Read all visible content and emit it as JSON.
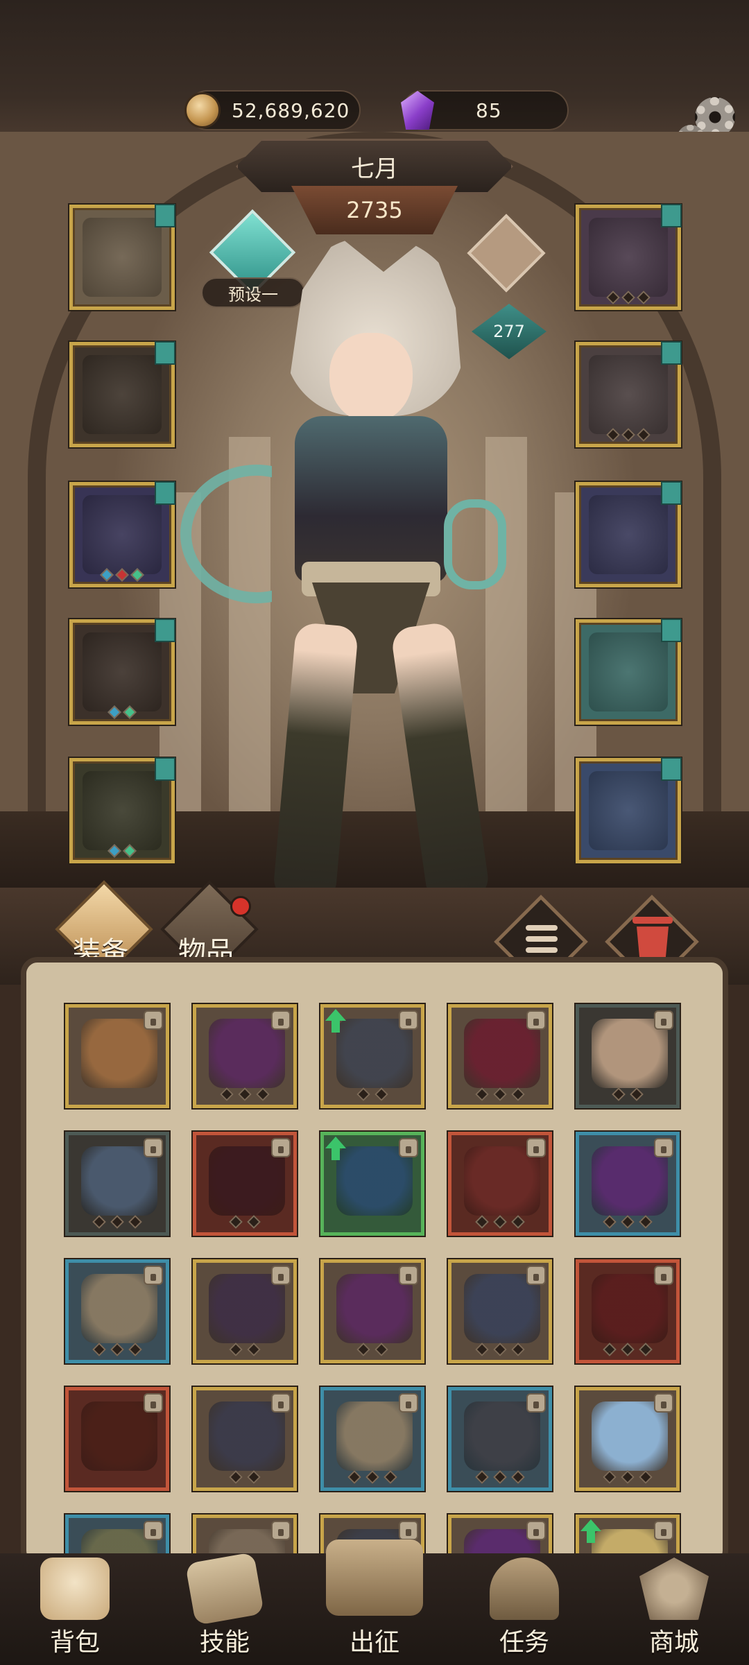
{
  "currencies": {
    "gold": "52,689,620",
    "gems": "85",
    "gold_icon": "gold-coin-icon",
    "gem_icon": "purple-crystal-icon"
  },
  "character": {
    "name": "七月",
    "power": "2735",
    "level": "277"
  },
  "preset": {
    "label": "预设一",
    "icon": "preset-gem-icon"
  },
  "equipment_slots": {
    "left": [
      {
        "name": "wings-slot",
        "sockets": []
      },
      {
        "name": "empty-armor-slot",
        "sockets": []
      },
      {
        "name": "shoulder-slot",
        "sockets": [
          "blue",
          "red",
          "green"
        ]
      },
      {
        "name": "pants-slot",
        "sockets": [
          "blue",
          "green"
        ]
      },
      {
        "name": "boots-slot",
        "sockets": [
          "blue",
          "green"
        ]
      }
    ],
    "right": [
      {
        "name": "necklace-slot",
        "sockets": [
          "empty",
          "empty",
          "empty"
        ]
      },
      {
        "name": "ring-slot",
        "sockets": [
          "empty",
          "empty",
          "empty"
        ]
      },
      {
        "name": "chain-ring-slot",
        "sockets": []
      },
      {
        "name": "bracer-slot",
        "sockets": []
      },
      {
        "name": "gauntlet-slot",
        "sockets": []
      }
    ]
  },
  "inventory": {
    "tabs": [
      {
        "label": "装备",
        "active": true
      },
      {
        "label": "物品",
        "active": false
      }
    ],
    "has_notification": true,
    "items": [
      {
        "frame": "gold",
        "upgrade": false,
        "sockets": 0,
        "color": "#9a6a3f"
      },
      {
        "frame": "gold",
        "upgrade": false,
        "sockets": 3,
        "color": "#5a2a5e"
      },
      {
        "frame": "gold",
        "upgrade": true,
        "sockets": 2,
        "color": "#40444f"
      },
      {
        "frame": "gold",
        "upgrade": false,
        "sockets": 3,
        "color": "#6a2030"
      },
      {
        "frame": "dark",
        "upgrade": false,
        "sockets": 2,
        "color": "#b79a80"
      },
      {
        "frame": "dark",
        "upgrade": false,
        "sockets": 3,
        "color": "#4b5b70"
      },
      {
        "frame": "red",
        "upgrade": false,
        "sockets": 2,
        "color": "#3a1a1f"
      },
      {
        "frame": "green",
        "upgrade": true,
        "sockets": 0,
        "color": "#2b4b6a"
      },
      {
        "frame": "red",
        "upgrade": false,
        "sockets": 3,
        "color": "#6a2a26"
      },
      {
        "frame": "blue",
        "upgrade": false,
        "sockets": 3,
        "color": "#5a2a6e"
      },
      {
        "frame": "blue",
        "upgrade": false,
        "sockets": 3,
        "color": "#8a7a62"
      },
      {
        "frame": "gold",
        "upgrade": false,
        "sockets": 2,
        "color": "#3f2f45"
      },
      {
        "frame": "gold",
        "upgrade": false,
        "sockets": 2,
        "color": "#5a2a5e"
      },
      {
        "frame": "gold",
        "upgrade": false,
        "sockets": 3,
        "color": "#3b4257"
      },
      {
        "frame": "red",
        "upgrade": false,
        "sockets": 3,
        "color": "#5a1e1e"
      },
      {
        "frame": "red",
        "upgrade": false,
        "sockets": 0,
        "color": "#4a2018"
      },
      {
        "frame": "gold",
        "upgrade": false,
        "sockets": 2,
        "color": "#3a3a4a"
      },
      {
        "frame": "blue",
        "upgrade": false,
        "sockets": 3,
        "color": "#8a7a62"
      },
      {
        "frame": "blue",
        "upgrade": false,
        "sockets": 3,
        "color": "#3e3f46"
      },
      {
        "frame": "gold",
        "upgrade": false,
        "sockets": 3,
        "color": "#8fb5d8"
      },
      {
        "frame": "blue",
        "upgrade": false,
        "sockets": 0,
        "color": "#6a6a4a"
      },
      {
        "frame": "gold",
        "upgrade": false,
        "sockets": 0,
        "color": "#7a6a58"
      },
      {
        "frame": "gold",
        "upgrade": false,
        "sockets": 0,
        "color": "#3a3d48"
      },
      {
        "frame": "gold",
        "upgrade": false,
        "sockets": 0,
        "color": "#5a2a6e"
      },
      {
        "frame": "gold",
        "upgrade": true,
        "sockets": 0,
        "color": "#c9b06a"
      }
    ]
  },
  "bottom_nav": [
    {
      "label": "背包",
      "icon": "backpack-icon"
    },
    {
      "label": "技能",
      "icon": "skill-scroll-icon"
    },
    {
      "label": "出征",
      "icon": "expedition-map-icon"
    },
    {
      "label": "任务",
      "icon": "quest-horn-icon"
    },
    {
      "label": "商城",
      "icon": "shop-crown-icon"
    }
  ]
}
